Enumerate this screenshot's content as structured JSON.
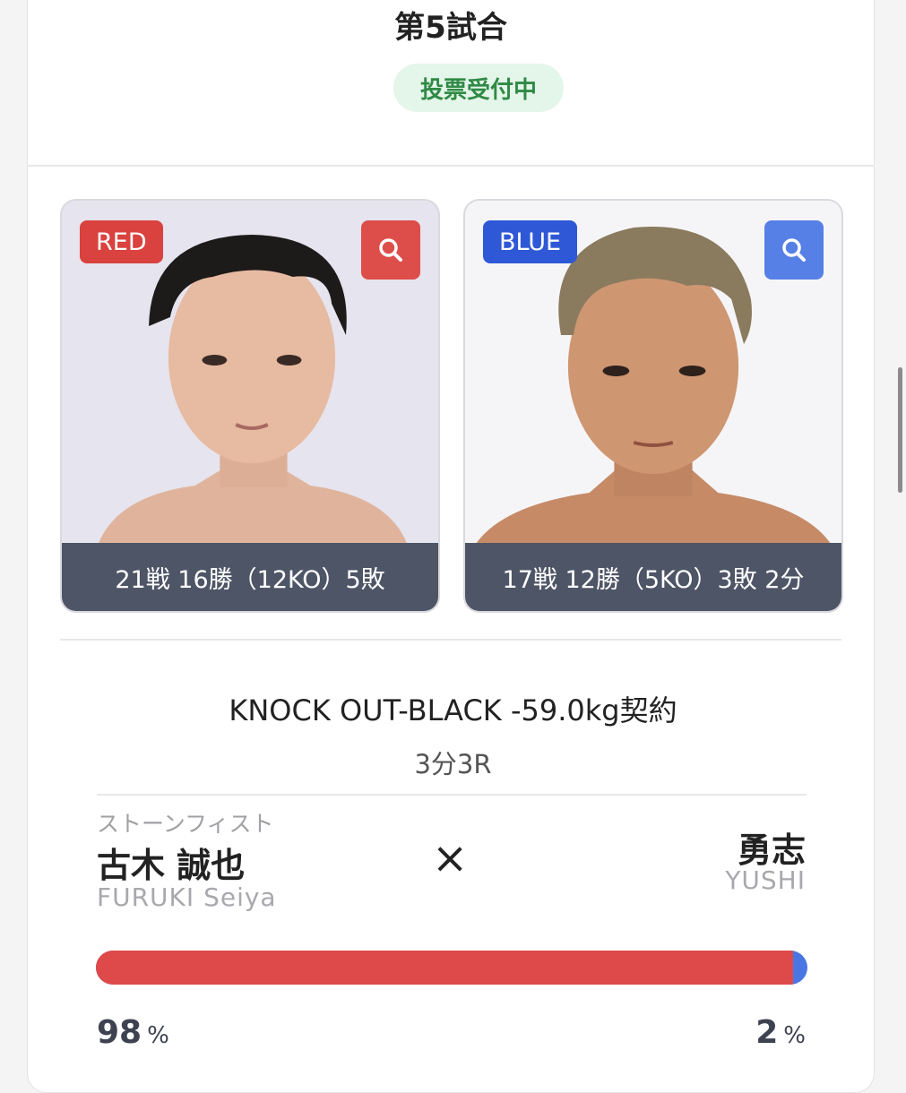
{
  "match": {
    "title": "第5試合",
    "status": "投票受付中"
  },
  "red": {
    "corner_label": "RED",
    "record": "21戦 16勝（12KO）5敗",
    "team": "ストーンフィスト",
    "name": "古木 誠也",
    "name_en": "FURUKI Seiya",
    "vote_percent": 98,
    "color": "#d9423e"
  },
  "blue": {
    "corner_label": "BLUE",
    "record": "17戦 12勝（5KO）3敗 2分",
    "name": "勇志",
    "name_en": "YUSHI",
    "vote_percent": 2,
    "color": "#2e58d6"
  },
  "bout": {
    "division": "KNOCK OUT-BLACK -59.0kg契約",
    "rounds": "3分3R",
    "vs": "×"
  },
  "percent_unit": "%",
  "icons": {
    "zoom": "search-icon",
    "photo": "fighter-photo"
  }
}
